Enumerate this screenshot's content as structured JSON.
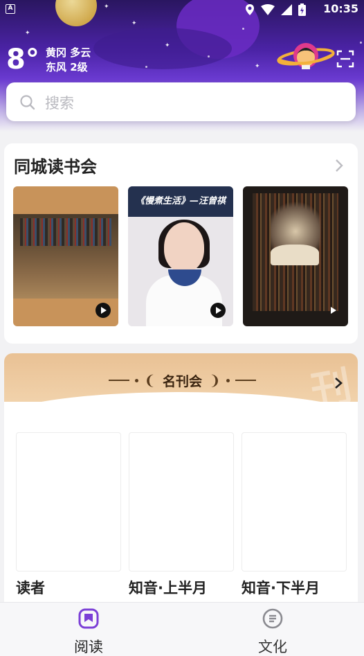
{
  "status_bar": {
    "time": "10:35",
    "notification_icon": "A"
  },
  "weather": {
    "temperature": "8°",
    "line1": "黄冈 多云",
    "line2": "东风 2级"
  },
  "search": {
    "placeholder": "搜索"
  },
  "reading_club": {
    "title": "同城读书会",
    "items": [
      {
        "caption": ""
      },
      {
        "caption": "《慢煮生活》—汪曾祺"
      },
      {
        "caption": ""
      }
    ]
  },
  "magazines": {
    "title": "名刊会",
    "watermark": "刊",
    "items": [
      {
        "name": "读者"
      },
      {
        "name": "知音·上半月"
      },
      {
        "name": "知音·下半月"
      }
    ]
  },
  "bottom_nav": {
    "items": [
      {
        "label": "阅读",
        "icon": "book-icon",
        "active": true
      },
      {
        "label": "文化",
        "icon": "list-circle-icon",
        "active": false
      }
    ]
  },
  "colors": {
    "header_purple": "#4b23a6",
    "accent_purple": "#6a3ad0",
    "magazine_banner": "#e9c194"
  }
}
